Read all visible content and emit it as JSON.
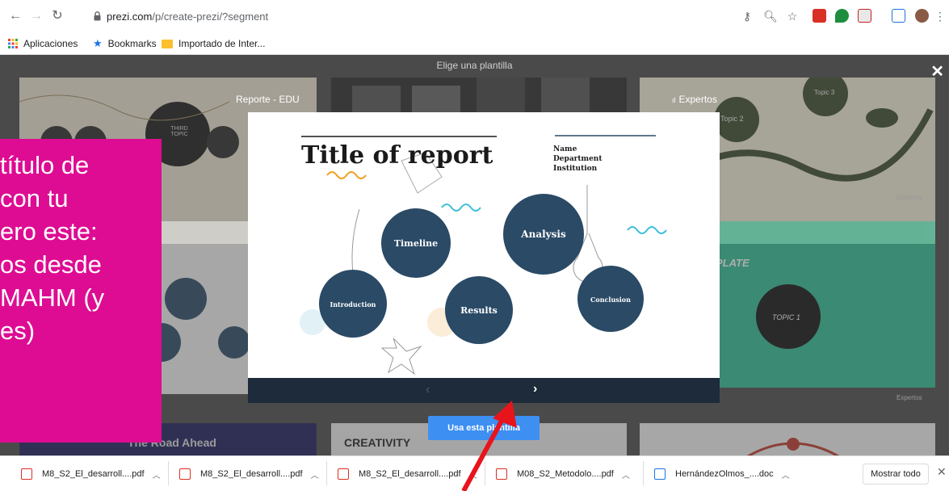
{
  "browser": {
    "url_host": "prezi.com",
    "url_path": "/p/create-prezi/?segment",
    "bookmarks": [
      "Aplicaciones",
      "Bookmarks",
      "Importado de Inter..."
    ]
  },
  "page": {
    "header": "Elige una plantilla",
    "modal_title": "Reporte - EDU",
    "modal_tag": "Expertos",
    "use_button": "Usa esta plantilla",
    "bg_tags": [
      "Expertos",
      "Expertos"
    ],
    "bg_texts": {
      "topic_third": "THIRD TOPIC",
      "topic2": "Topic 2",
      "topic3": "Topic 3",
      "plate": "PLATE",
      "topic1": "TOPIC 1",
      "road": "The Road Ahead",
      "creativity": "CREATIVITY"
    }
  },
  "template": {
    "title": "Title of report",
    "meta": [
      "Name",
      "Department",
      "Institution"
    ],
    "circles": [
      "Timeline",
      "Analysis",
      "Introduction",
      "Results",
      "Conclusion"
    ]
  },
  "note": {
    "lines": [
      "título de",
      "con tu",
      "ero este:",
      "os desde",
      "MAHM (y",
      "es)"
    ]
  },
  "downloads": {
    "items": [
      "M8_S2_El_desarroll....pdf",
      "M8_S2_El_desarroll....pdf",
      "M8_S2_El_desarroll....pdf",
      "M08_S2_Metodolo....pdf",
      "HernándezOlmos_....doc"
    ],
    "show_all": "Mostrar todo"
  },
  "colors": {
    "note_bg": "#dd0c93",
    "accent": "#3d8ff2",
    "circle": "#2a4a66",
    "arrow": "#e8141c"
  }
}
